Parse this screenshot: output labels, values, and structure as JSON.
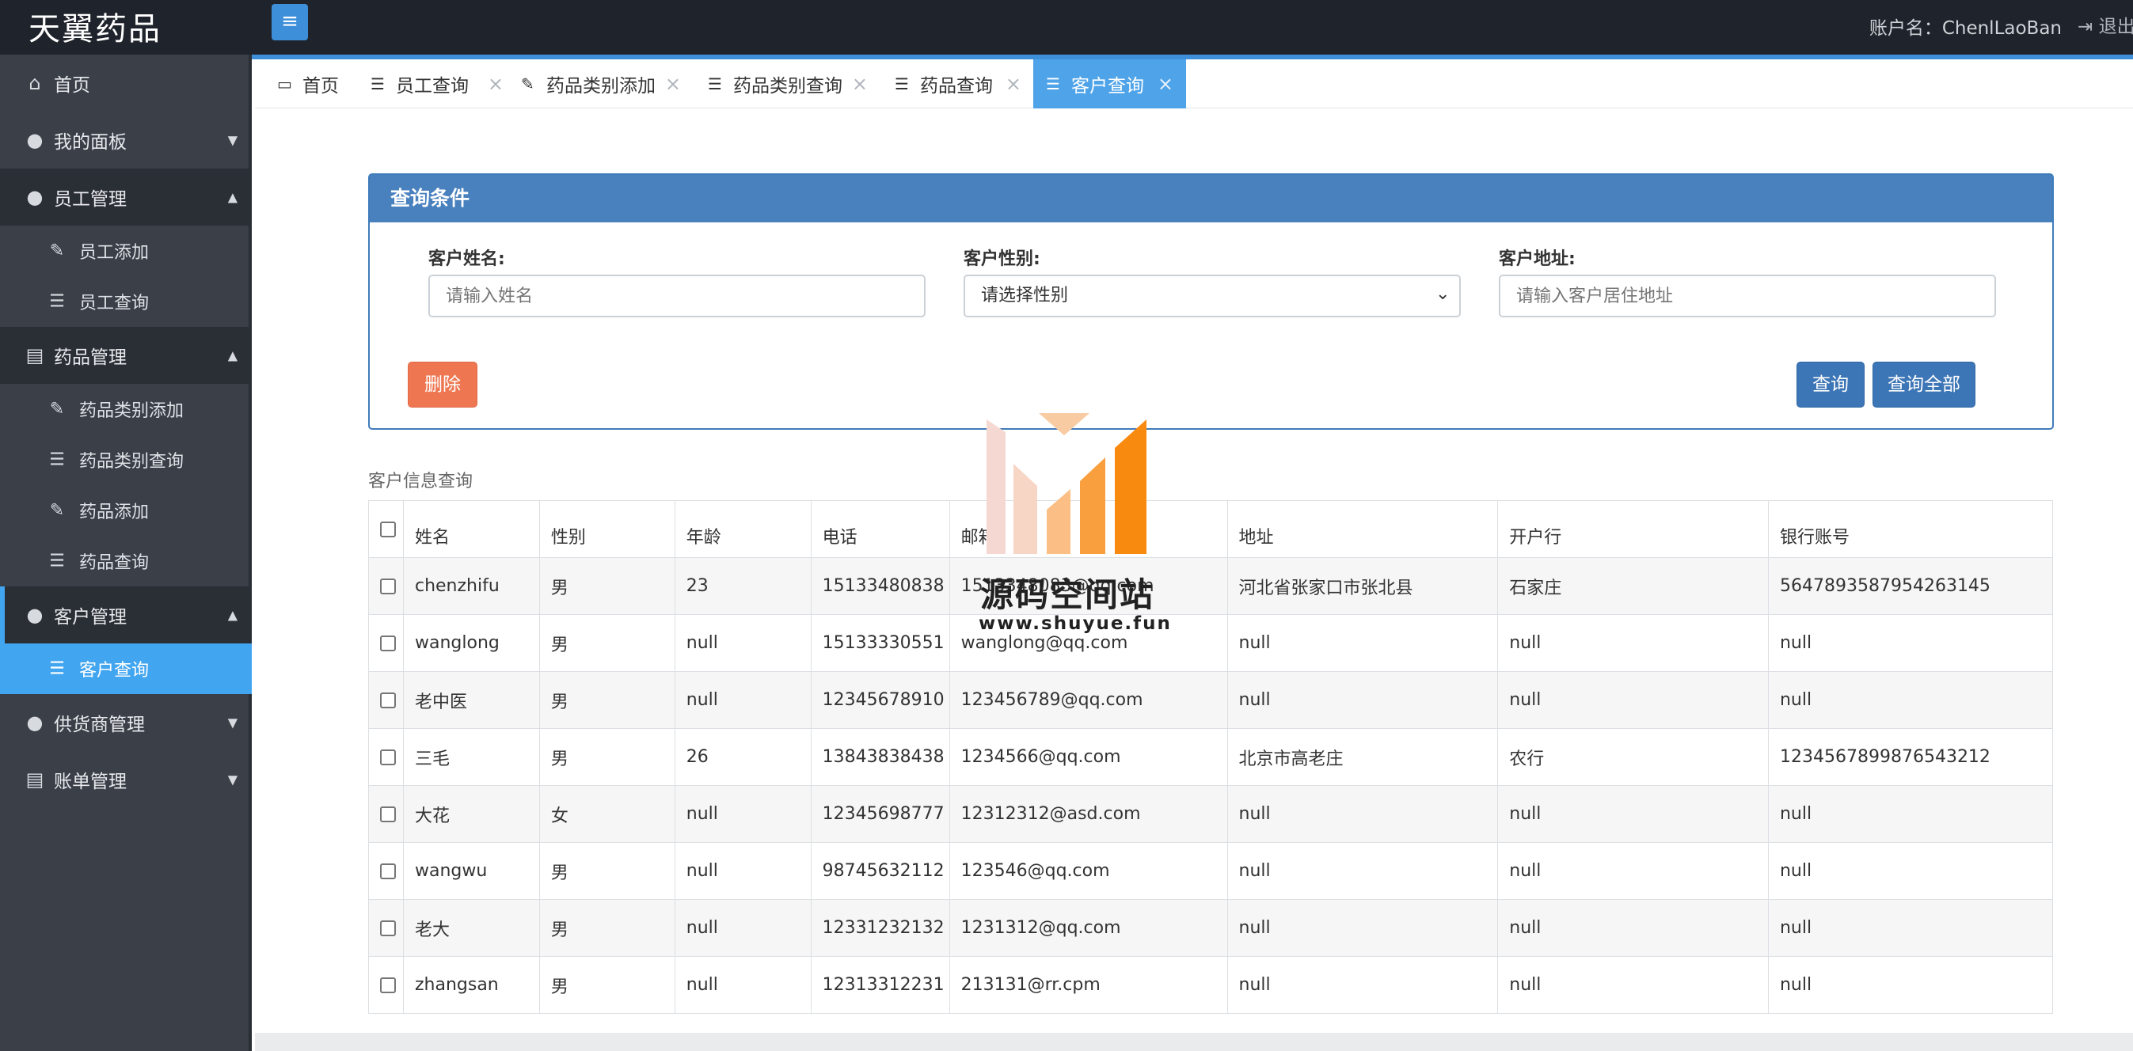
{
  "app": {
    "brand": "天翼药品",
    "menu_toggle": "≡",
    "account_label": "账户名：ChenlLaoBan",
    "logout_label": "退出"
  },
  "sidebar": {
    "items": [
      {
        "label": "首页",
        "icon": "home-icon"
      },
      {
        "label": "我的面板",
        "icon": "user-icon"
      },
      {
        "label": "员工管理",
        "icon": "users-icon"
      },
      {
        "label": "员工添加",
        "icon": "edit-icon"
      },
      {
        "label": "员工查询",
        "icon": "list-icon"
      },
      {
        "label": "药品管理",
        "icon": "file-icon"
      },
      {
        "label": "药品类别添加",
        "icon": "edit-icon"
      },
      {
        "label": "药品类别查询",
        "icon": "list-icon"
      },
      {
        "label": "药品添加",
        "icon": "edit-icon"
      },
      {
        "label": "药品查询",
        "icon": "list-icon"
      },
      {
        "label": "客户管理",
        "icon": "users-icon"
      },
      {
        "label": "客户查询",
        "icon": "list-icon"
      },
      {
        "label": "供货商管理",
        "icon": "users-icon"
      },
      {
        "label": "账单管理",
        "icon": "file-icon"
      }
    ]
  },
  "tabs": [
    {
      "label": "首页"
    },
    {
      "label": "员工查询"
    },
    {
      "label": "药品类别添加"
    },
    {
      "label": "药品类别查询"
    },
    {
      "label": "药品查询"
    },
    {
      "label": "客户查询"
    }
  ],
  "query": {
    "title": "查询条件",
    "name_label": "客户姓名:",
    "name_placeholder": "请输入姓名",
    "gender_label": "客户性别:",
    "gender_selected": "请选择性别",
    "address_label": "客户地址:",
    "address_placeholder": "请输入客户居住地址",
    "delete_button": "删除",
    "search_button": "查询",
    "search_all_button": "查询全部"
  },
  "table": {
    "caption": "客户信息查询",
    "headers": [
      "姓名",
      "性别",
      "年龄",
      "电话",
      "邮箱",
      "地址",
      "开户行",
      "银行账号"
    ],
    "rows": [
      [
        "chenzhifu",
        "男",
        "23",
        "15133480838",
        "1513348083@qq.com",
        "河北省张家口市张北县",
        "石家庄",
        "5647893587954263145"
      ],
      [
        "wanglong",
        "男",
        "null",
        "15133330551",
        "wanglong@qq.com",
        "null",
        "null",
        "null"
      ],
      [
        "老中医",
        "男",
        "null",
        "12345678910",
        "123456789@qq.com",
        "null",
        "null",
        "null"
      ],
      [
        "三毛",
        "男",
        "26",
        "13843838438",
        "1234566@qq.com",
        "北京市高老庄",
        "农行",
        "1234567899876543212"
      ],
      [
        "大花",
        "女",
        "null",
        "12345698777",
        "12312312@asd.com",
        "null",
        "null",
        "null"
      ],
      [
        "wangwu",
        "男",
        "null",
        "98745632112",
        "123546@qq.com",
        "null",
        "null",
        "null"
      ],
      [
        "老大",
        "男",
        "null",
        "12331232132",
        "1231312@qq.com",
        "null",
        "null",
        "null"
      ],
      [
        "zhangsan",
        "男",
        "null",
        "12313312231",
        "213131@rr.cpm",
        "null",
        "null",
        "null"
      ]
    ]
  },
  "watermark": {
    "text": "源码空间站",
    "url": "www.shuyue.fun"
  },
  "colors": {
    "topbar": "#1f232b",
    "sidebar": "#3a3f48",
    "accent": "#3d8fd9",
    "active_tab": "#4fa3e8",
    "panel_header": "#4981be",
    "danger": "#ee7752",
    "primary": "#3d76b6"
  }
}
